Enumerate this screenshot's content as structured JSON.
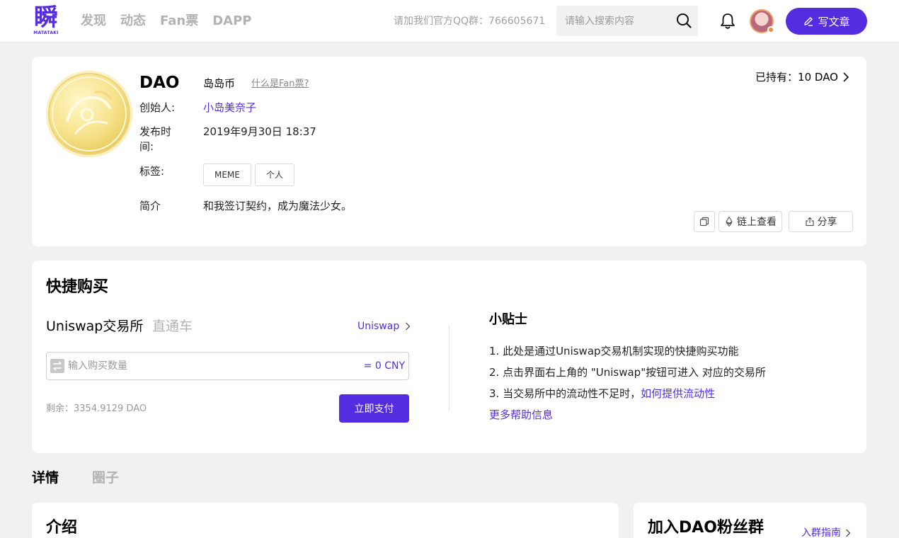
{
  "header": {
    "logo_mark": "瞬",
    "logo_sub": "MATATAKI",
    "nav": [
      "发现",
      "动态",
      "Fan票",
      "DAPP"
    ],
    "qq_group_text": "请加我们官方QQ群：766605671",
    "search_placeholder": "请输入搜索内容",
    "write_label": "写文章"
  },
  "token": {
    "symbol": "DAO",
    "name": "岛岛币",
    "what_is_fan": "什么是Fan票?",
    "creator_label": "创始人:",
    "creator": "小岛美奈子",
    "release_label_1": "发布时",
    "release_label_2": "间:",
    "release_time": "2019年9月30日 18:37",
    "tags_label": "标签:",
    "tags": [
      "MEME",
      "个人"
    ],
    "intro_label": "简介",
    "intro": "和我签订契约，成为魔法少女。",
    "holding": "已持有：10 DAO",
    "chain_view": "链上查看",
    "share": "分享"
  },
  "quick_buy": {
    "title": "快捷购买",
    "tab_uniswap": "Uniswap交易所",
    "tab_direct": "直通车",
    "uniswap_link": "Uniswap",
    "amount_placeholder": "输入购买数量",
    "cny_value": "= 0 CNY",
    "remaining": "剩余：3354.9129 DAO",
    "pay_label": "立即支付",
    "tips_title": "小贴士",
    "tip1": "1. 此处是通过Uniswap交易机制实现的快捷购买功能",
    "tip2": "2. 点击界面右上角的 \"Uniswap\"按钮可进入 对应的交易所",
    "tip3_prefix": "3. 当交易所中的流动性不足时，",
    "tip3_link": "如何提供流动性",
    "more_help": "更多帮助信息"
  },
  "detail_tabs": [
    "详情",
    "圈子"
  ],
  "intro_section": {
    "title": "介绍"
  },
  "group_section": {
    "title": "加入DAO粉丝群",
    "guide": "入群指南"
  },
  "colors": {
    "accent": "#542de0",
    "background": "#f1f1f1"
  }
}
